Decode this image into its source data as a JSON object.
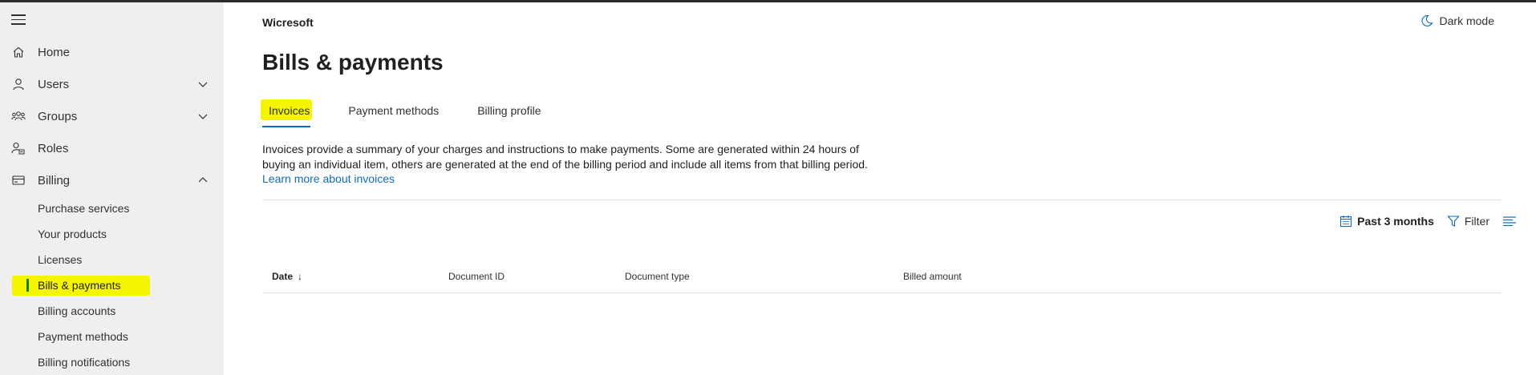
{
  "sidebar": {
    "items": [
      {
        "label": "Home",
        "icon": "home-icon"
      },
      {
        "label": "Users",
        "icon": "user-icon"
      },
      {
        "label": "Groups",
        "icon": "groups-icon"
      },
      {
        "label": "Roles",
        "icon": "roles-icon"
      },
      {
        "label": "Billing",
        "icon": "billing-icon"
      }
    ],
    "billing_sub": [
      "Purchase services",
      "Your products",
      "Licenses",
      "Bills & payments",
      "Billing accounts",
      "Payment methods",
      "Billing notifications"
    ],
    "active_sub": "Bills & payments",
    "highlight_color": "#f5f500"
  },
  "header": {
    "org": "Wicresoft",
    "dark_mode": "Dark mode",
    "title": "Bills & payments"
  },
  "tabs": [
    "Invoices",
    "Payment methods",
    "Billing profile"
  ],
  "active_tab": "Invoices",
  "description": {
    "line1": "Invoices provide a summary of your charges and instructions to make payments. Some are generated within 24 hours of",
    "line2": "buying an individual item, others are generated at the end of the billing period and include all items from that billing period.",
    "link": "Learn more about invoices"
  },
  "toolbar": {
    "period": "Past 3 months",
    "filter": "Filter"
  },
  "table": {
    "columns": [
      "Date",
      "Document ID",
      "Document type",
      "Billed amount"
    ],
    "sort_indicator": "↓"
  },
  "colors": {
    "accent": "#0f6cbd",
    "active_bar": "#107c10"
  }
}
